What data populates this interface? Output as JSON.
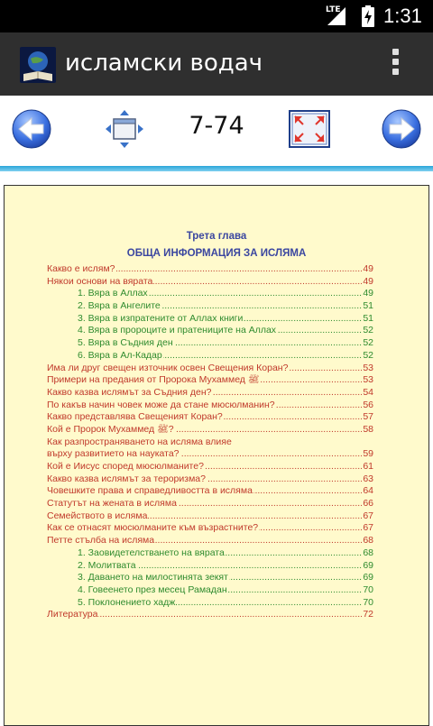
{
  "status_bar": {
    "network": "LTE",
    "time": "1:31",
    "icons": [
      "signal-icon",
      "battery-charging-icon"
    ]
  },
  "app_bar": {
    "title": "исламски водач",
    "icon": "book-globe-app-icon",
    "menu_icon": "overflow-menu-icon"
  },
  "toolbar": {
    "prev_icon": "arrow-left-icon",
    "resize_icon": "window-move-icon",
    "page": "7-74",
    "fullscreen_icon": "fullscreen-icon",
    "next_icon": "arrow-right-icon"
  },
  "document": {
    "chapter_label": "Трета глава",
    "chapter_title": "ОБЩА ИНФОРМАЦИЯ ЗА ИСЛЯМА",
    "toc": [
      {
        "label": "Какво е ислям?",
        "page": "49",
        "color": "red",
        "sub": false
      },
      {
        "label": "Някои основи на вярата",
        "page": "49",
        "color": "red",
        "sub": false
      },
      {
        "label": "1. Вяра в Аллах",
        "page": "49",
        "color": "green",
        "sub": true
      },
      {
        "label": "2. Вяра в Ангелите",
        "page": "51",
        "color": "green",
        "sub": true
      },
      {
        "label": "3. Вяра в изпратените от Аллах книги",
        "page": "51",
        "color": "green",
        "sub": true
      },
      {
        "label": "4. Вяра в пророците и пратениците на Аллах",
        "page": "52",
        "color": "green",
        "sub": true
      },
      {
        "label": "5. Вяра в Съдния ден",
        "page": "52",
        "color": "green",
        "sub": true
      },
      {
        "label": "6. Вяра в Ал-Кадар",
        "page": "52",
        "color": "green",
        "sub": true
      },
      {
        "label": "Има ли друг свещен източник освен Свещения Коран?",
        "page": "53",
        "color": "red",
        "sub": false
      },
      {
        "label": "Примери на предания от Пророка Мухаммед ﷺ",
        "page": "53",
        "color": "red",
        "sub": false
      },
      {
        "label": "Какво казва ислямът за Съдния ден?",
        "page": "54",
        "color": "red",
        "sub": false
      },
      {
        "label": "По какъв начин човек може да стане мюсюлманин?",
        "page": "56",
        "color": "red",
        "sub": false
      },
      {
        "label": "Какво представлява Свещеният Коран?",
        "page": "57",
        "color": "red",
        "sub": false
      },
      {
        "label": "Кой е Пророк Мухаммед ﷺ?",
        "page": "58",
        "color": "red",
        "sub": false
      },
      {
        "label": "Как разпространяването на исляма влияе",
        "page": "",
        "color": "red",
        "sub": false,
        "cont": true
      },
      {
        "label": "върху развитието на науката?",
        "page": "59",
        "color": "red",
        "sub": false
      },
      {
        "label": "Кой е Иисус според мюсюлманите?",
        "page": "61",
        "color": "red",
        "sub": false
      },
      {
        "label": "Какво казва ислямът за тероризма?",
        "page": "63",
        "color": "red",
        "sub": false
      },
      {
        "label": "Човешките права и справедливостта в исляма",
        "page": "64",
        "color": "red",
        "sub": false
      },
      {
        "label": "Статутът на жената в исляма",
        "page": "66",
        "color": "red",
        "sub": false
      },
      {
        "label": "Семейството в исляма",
        "page": "67",
        "color": "red",
        "sub": false
      },
      {
        "label": "Как се отнасят мюсюлманите към възрастните?",
        "page": "67",
        "color": "red",
        "sub": false
      },
      {
        "label": "Петте стълба на исляма",
        "page": "68",
        "color": "red",
        "sub": false
      },
      {
        "label": "1. Заовидетелстването на вярата",
        "page": "68",
        "color": "green",
        "sub": true
      },
      {
        "label": "2. Молитвата",
        "page": "69",
        "color": "green",
        "sub": true
      },
      {
        "label": "3. Даването на милостинята зекят",
        "page": "69",
        "color": "green",
        "sub": true
      },
      {
        "label": "4. Говеенето през месец Рамадан",
        "page": "70",
        "color": "green",
        "sub": true
      },
      {
        "label": "5. Поклонението хадж",
        "page": "70",
        "color": "green",
        "sub": true
      },
      {
        "label": "Литература",
        "page": "72",
        "color": "red",
        "sub": false
      }
    ]
  }
}
